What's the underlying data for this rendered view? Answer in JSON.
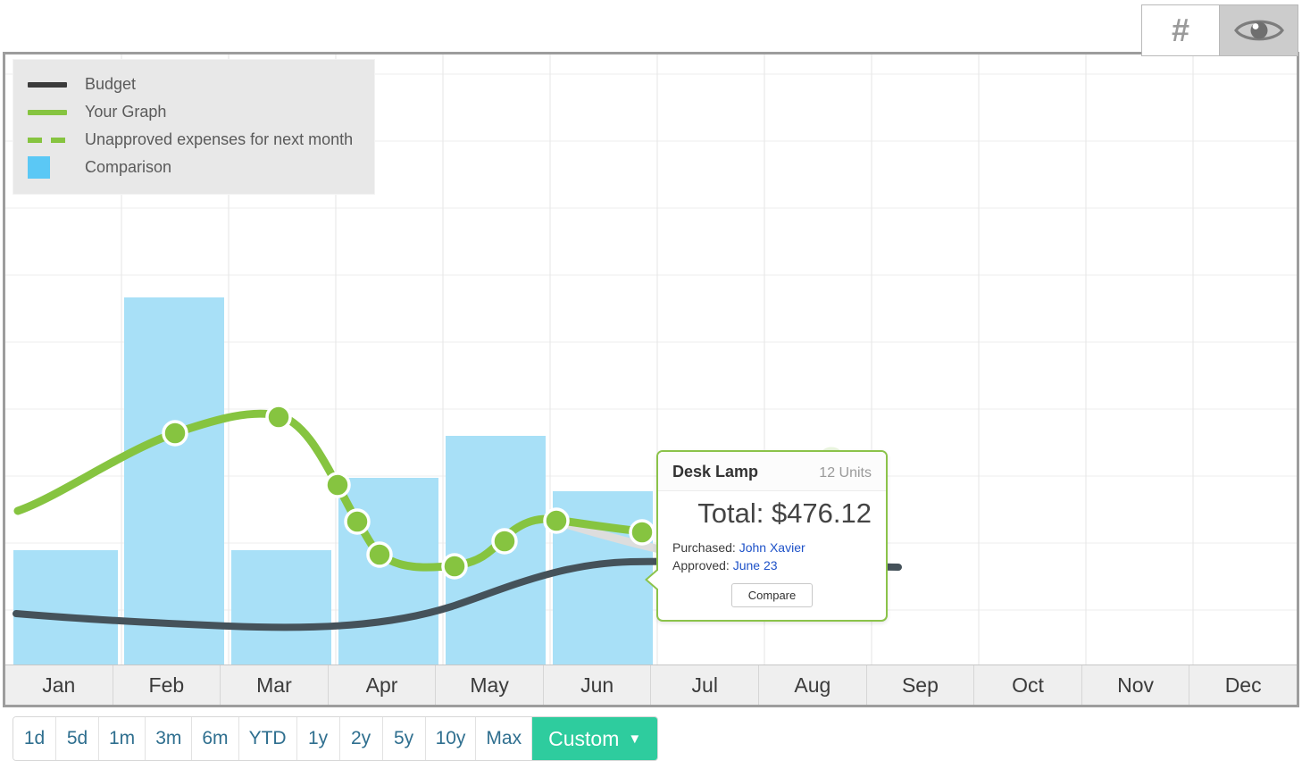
{
  "toolbar": {
    "buttons": [
      {
        "name": "hash-button",
        "glyph": "#",
        "active": false
      },
      {
        "name": "eye-button",
        "glyph": "eye-icon",
        "active": true
      }
    ]
  },
  "legend": {
    "items": [
      {
        "label": "Budget",
        "style": "solid-line",
        "color": "#3b3b3b"
      },
      {
        "label": "Your Graph",
        "style": "solid-line",
        "color": "#86c440"
      },
      {
        "label": "Unapproved expenses for next month",
        "style": "dashed-line",
        "color": "#86c440"
      },
      {
        "label": "Comparison",
        "style": "box",
        "color": "#5bc8f5"
      }
    ]
  },
  "tooltip": {
    "title": "Desk Lamp",
    "units": "12 Units",
    "total": "Total: $476.12",
    "purchased_label": "Purchased:",
    "purchased_value": "John Xavier",
    "approved_label": "Approved:",
    "approved_value": "June 23",
    "compare_button": "Compare"
  },
  "range_selector": {
    "options": [
      {
        "label": "1d",
        "active": false
      },
      {
        "label": "5d",
        "active": false
      },
      {
        "label": "1m",
        "active": false
      },
      {
        "label": "3m",
        "active": false
      },
      {
        "label": "6m",
        "active": false
      },
      {
        "label": "YTD",
        "active": false
      },
      {
        "label": "1y",
        "active": false
      },
      {
        "label": "2y",
        "active": false
      },
      {
        "label": "5y",
        "active": false
      },
      {
        "label": "10y",
        "active": false
      },
      {
        "label": "Max",
        "active": false
      },
      {
        "label": "Custom",
        "active": true,
        "chevron": "⌄"
      }
    ]
  },
  "chart_data": {
    "type": "line",
    "title": "",
    "xlabel": "",
    "ylabel": "",
    "grid": true,
    "legend_position": "top-left",
    "categories": [
      "Jan",
      "Feb",
      "Mar",
      "Apr",
      "May",
      "Jun",
      "Jul",
      "Aug",
      "Sep",
      "Oct",
      "Nov",
      "Dec"
    ],
    "ylim": [
      0,
      100
    ],
    "series": [
      {
        "name": "Comparison",
        "type": "bar",
        "color": "#a8e0f7",
        "values": [
          18,
          60,
          18,
          30,
          37,
          28,
          null,
          null,
          null,
          null,
          null,
          null
        ]
      },
      {
        "name": "Your Graph",
        "type": "line",
        "color": "#86c440",
        "markers": true,
        "x": [
          0.05,
          1.5,
          2.45,
          3.0,
          3.2,
          3.45,
          4.15,
          4.6,
          5.05,
          5.85
        ],
        "values": [
          25,
          38,
          41,
          29,
          23,
          18,
          16,
          20,
          23,
          21
        ]
      },
      {
        "name": "Budget",
        "type": "line",
        "color": "#45525a",
        "markers": false,
        "values": [
          11,
          10,
          9,
          9,
          10,
          14,
          20,
          21,
          21,
          21,
          21,
          21
        ]
      },
      {
        "name": "Unapproved expenses for next month",
        "type": "line",
        "style": "dashed",
        "color": "#cfe8b3",
        "values": [
          null,
          null,
          null,
          null,
          null,
          21,
          19,
          null,
          null,
          null,
          null,
          null
        ]
      }
    ]
  }
}
